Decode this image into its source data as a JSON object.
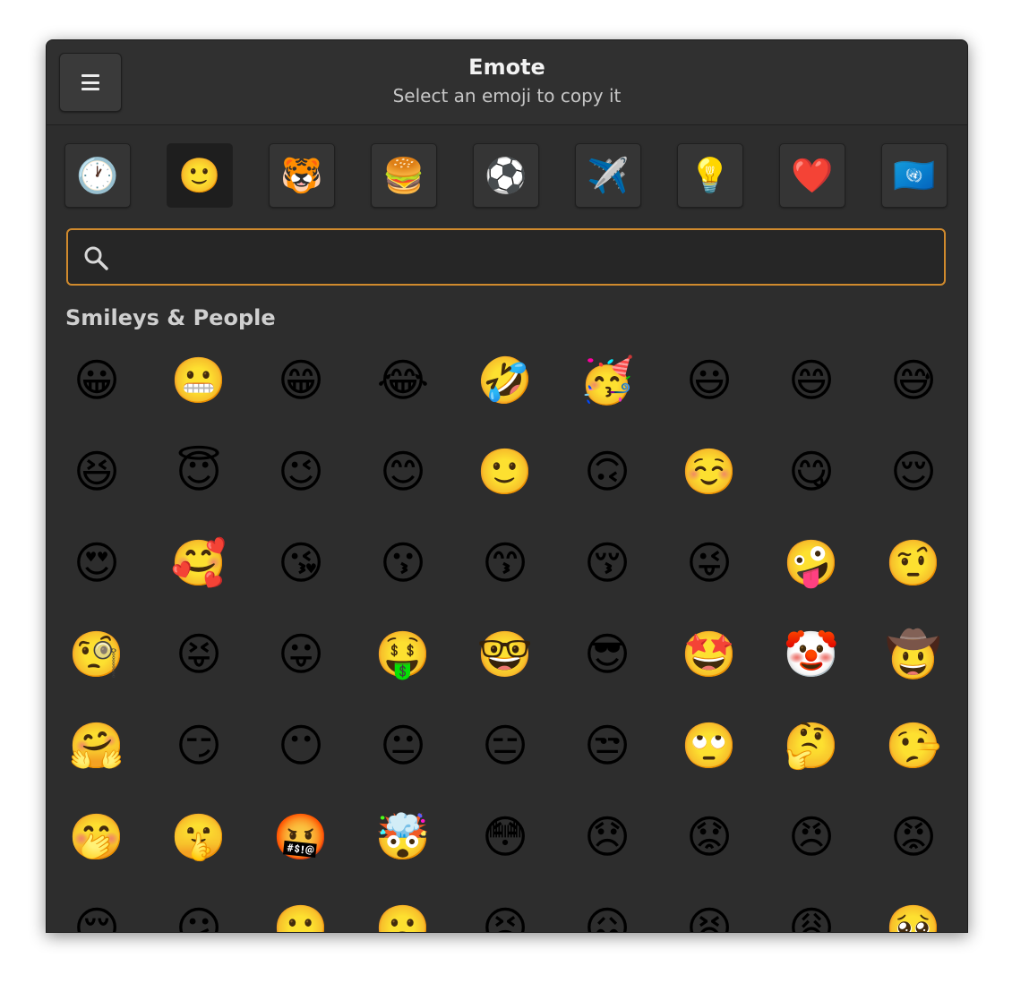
{
  "app": {
    "title": "Emote",
    "subtitle": "Select an emoji to copy it"
  },
  "categories": [
    {
      "id": "recent",
      "glyph": "🕐",
      "icon": "clock-icon",
      "active": false
    },
    {
      "id": "smileys",
      "glyph": "🙂",
      "icon": "smiley-icon",
      "active": true
    },
    {
      "id": "animals",
      "glyph": "🐯",
      "icon": "tiger-icon",
      "active": false
    },
    {
      "id": "food",
      "glyph": "🍔",
      "icon": "burger-icon",
      "active": false
    },
    {
      "id": "activities",
      "glyph": "⚽",
      "icon": "soccer-ball-icon",
      "active": false
    },
    {
      "id": "travel",
      "glyph": "✈️",
      "icon": "airplane-icon",
      "active": false
    },
    {
      "id": "objects",
      "glyph": "💡",
      "icon": "lightbulb-icon",
      "active": false
    },
    {
      "id": "symbols",
      "glyph": "❤️",
      "icon": "heart-icon",
      "active": false
    },
    {
      "id": "flags",
      "glyph": "🇺🇳",
      "icon": "un-flag-icon",
      "active": false
    }
  ],
  "search": {
    "value": "",
    "placeholder": "",
    "accent_color": "#d08a2d"
  },
  "section": {
    "title": "Smileys & People"
  },
  "emojis": [
    "😀",
    "😬",
    "😁",
    "😂",
    "🤣",
    "🥳",
    "😃",
    "😄",
    "😅",
    "😆",
    "😇",
    "😉",
    "😊",
    "🙂",
    "🙃",
    "☺️",
    "😋",
    "😌",
    "😍",
    "🥰",
    "😘",
    "😗",
    "😙",
    "😚",
    "😜",
    "🤪",
    "🤨",
    "🧐",
    "😝",
    "😛",
    "🤑",
    "🤓",
    "😎",
    "🤩",
    "🤡",
    "🤠",
    "🤗",
    "😏",
    "😶",
    "😐",
    "😑",
    "😒",
    "🙄",
    "🤔",
    "🤥",
    "🤭",
    "🤫",
    "🤬",
    "🤯",
    "😳",
    "😞",
    "😟",
    "😠",
    "😡",
    "😔",
    "😕",
    "🙁",
    "☹️",
    "😣",
    "😖",
    "😫",
    "😩",
    "🥺"
  ]
}
